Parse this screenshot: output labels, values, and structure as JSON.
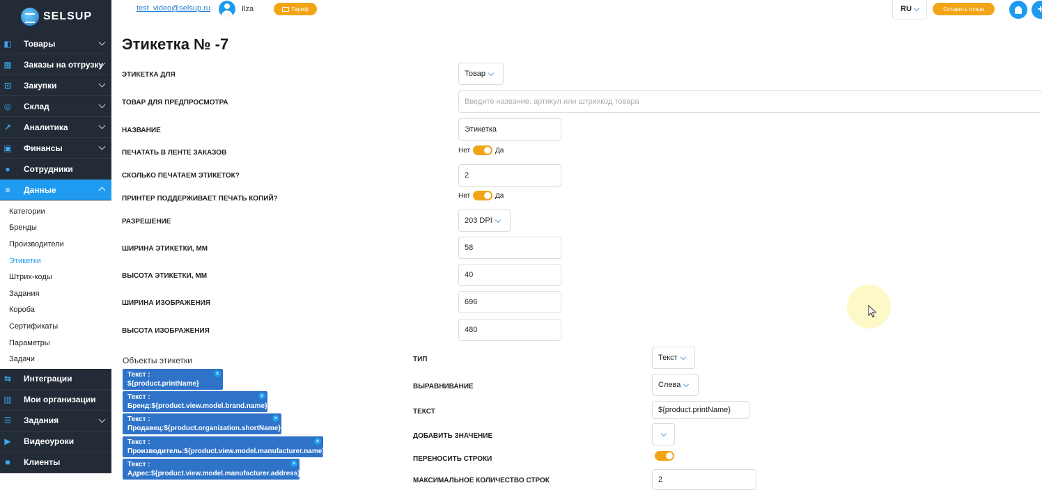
{
  "logo": {
    "text": "SELSUP"
  },
  "sidebar": {
    "top_items": [
      {
        "label": "Товары",
        "icon": "bag-icon",
        "glyph": "◧",
        "chevron": true
      },
      {
        "label": "Заказы на отгрузку",
        "icon": "box-icon",
        "glyph": "▦",
        "chevron": true
      },
      {
        "label": "Закупки",
        "icon": "cart-icon",
        "glyph": "⊡",
        "chevron": true
      },
      {
        "label": "Склад",
        "icon": "check-circle-icon",
        "glyph": "◎",
        "chevron": true
      },
      {
        "label": "Аналитика",
        "icon": "chart-icon",
        "glyph": "↗",
        "chevron": true
      },
      {
        "label": "Финансы",
        "icon": "wallet-icon",
        "glyph": "▣",
        "chevron": true
      },
      {
        "label": "Сотрудники",
        "icon": "user-icon",
        "glyph": "●",
        "chevron": false
      },
      {
        "label": "Данные",
        "icon": "database-icon",
        "glyph": "≡",
        "chevron": true,
        "active": true
      }
    ],
    "sub_items": [
      {
        "label": "Категории"
      },
      {
        "label": "Бренды"
      },
      {
        "label": "Производители"
      },
      {
        "label": "Этикетки",
        "current": true
      },
      {
        "label": "Штрих-коды"
      },
      {
        "label": "Задания"
      },
      {
        "label": "Короба"
      },
      {
        "label": "Сертификаты"
      },
      {
        "label": "Параметры"
      },
      {
        "label": "Задачи"
      }
    ],
    "bottom_items": [
      {
        "label": "Интеграции",
        "icon": "integration-icon",
        "glyph": "⇆",
        "chevron": false
      },
      {
        "label": "Мои организации",
        "icon": "building-icon",
        "glyph": "▥",
        "chevron": false
      },
      {
        "label": "Задания",
        "icon": "tasks-icon",
        "glyph": "☰",
        "chevron": true
      },
      {
        "label": "Видеоуроки",
        "icon": "video-icon",
        "glyph": "▶",
        "chevron": false
      },
      {
        "label": "Клиенты",
        "icon": "lock-icon",
        "glyph": "■",
        "chevron": false
      }
    ]
  },
  "topbar": {
    "email": "test_video@selsup.ru",
    "user_name": "Ilza",
    "tariff_label": "Тариф",
    "lang": "RU",
    "feedback_label": "Оставить отзыв"
  },
  "page": {
    "title": "Этикетка № -7"
  },
  "form": {
    "label_for": {
      "label": "ЭТИКЕТКА ДЛЯ",
      "value": "Товар"
    },
    "preview_product": {
      "label": "ТОВАР ДЛЯ ПРЕДПРОСМОТРА",
      "placeholder": "Введите название, артикул или штрихкод товара"
    },
    "name": {
      "label": "НАЗВАНИЕ",
      "value": "Этикетка"
    },
    "print_in_feed": {
      "label": "ПЕЧАТАТЬ В ЛЕНТЕ ЗАКАЗОВ",
      "off": "Нет",
      "on": "Да",
      "checked": true
    },
    "labels_count": {
      "label": "СКОЛЬКО ПЕЧАТАЕМ ЭТИКЕТОК?",
      "value": "2"
    },
    "printer_copies": {
      "label": "ПРИНТЕР ПОДДЕРЖИВАЕТ ПЕЧАТЬ КОПИЙ?",
      "off": "Нет",
      "on": "Да",
      "checked": true
    },
    "resolution": {
      "label": "РАЗРЕШЕНИЕ",
      "value": "203 DPI"
    },
    "label_width": {
      "label": "ШИРИНА ЭТИКЕТКИ, ММ",
      "value": "58"
    },
    "label_height": {
      "label": "ВЫСОТА ЭТИКЕТКИ, ММ",
      "value": "40"
    },
    "image_width": {
      "label": "ШИРИНА ИЗОБРАЖЕНИЯ",
      "value": "696"
    },
    "image_height": {
      "label": "ВЫСОТА ИЗОБРАЖЕНИЯ",
      "value": "480"
    }
  },
  "objects": {
    "title": "Объекты этикетки",
    "items": [
      {
        "line1": "Текст :",
        "line2": "${product.printName}"
      },
      {
        "line1": "Текст :",
        "line2": "Бренд:${product.view.model.brand.name}"
      },
      {
        "line1": "Текст :",
        "line2": "Продавец:${product.organization.shortName}"
      },
      {
        "line1": "Текст :",
        "line2": "Производитель:${product.view.model.manufacturer.name}"
      },
      {
        "line1": "Текст :",
        "line2": "Адрес:${product.view.model.manufacturer.address}"
      }
    ]
  },
  "object_props": {
    "type": {
      "label": "ТИП",
      "value": "Текст"
    },
    "align": {
      "label": "ВЫРАВНИВАНИЕ",
      "value": "Слева"
    },
    "text": {
      "label": "ТЕКСТ",
      "value": "${product.printName}"
    },
    "add_value": {
      "label": "ДОБАВИТЬ ЗНАЧЕНИЕ"
    },
    "wrap": {
      "label": "ПЕРЕНОСИТЬ СТРОКИ",
      "checked": true
    },
    "max_lines": {
      "label": "МАКСИМАЛЬНОЕ КОЛИЧЕСТВО СТРОК",
      "value": "2"
    }
  },
  "colors": {
    "accent": "#1e9bf0",
    "sidebar_bg": "#232b36",
    "orange": "#f2a417",
    "object_chip": "#2e73c8"
  }
}
